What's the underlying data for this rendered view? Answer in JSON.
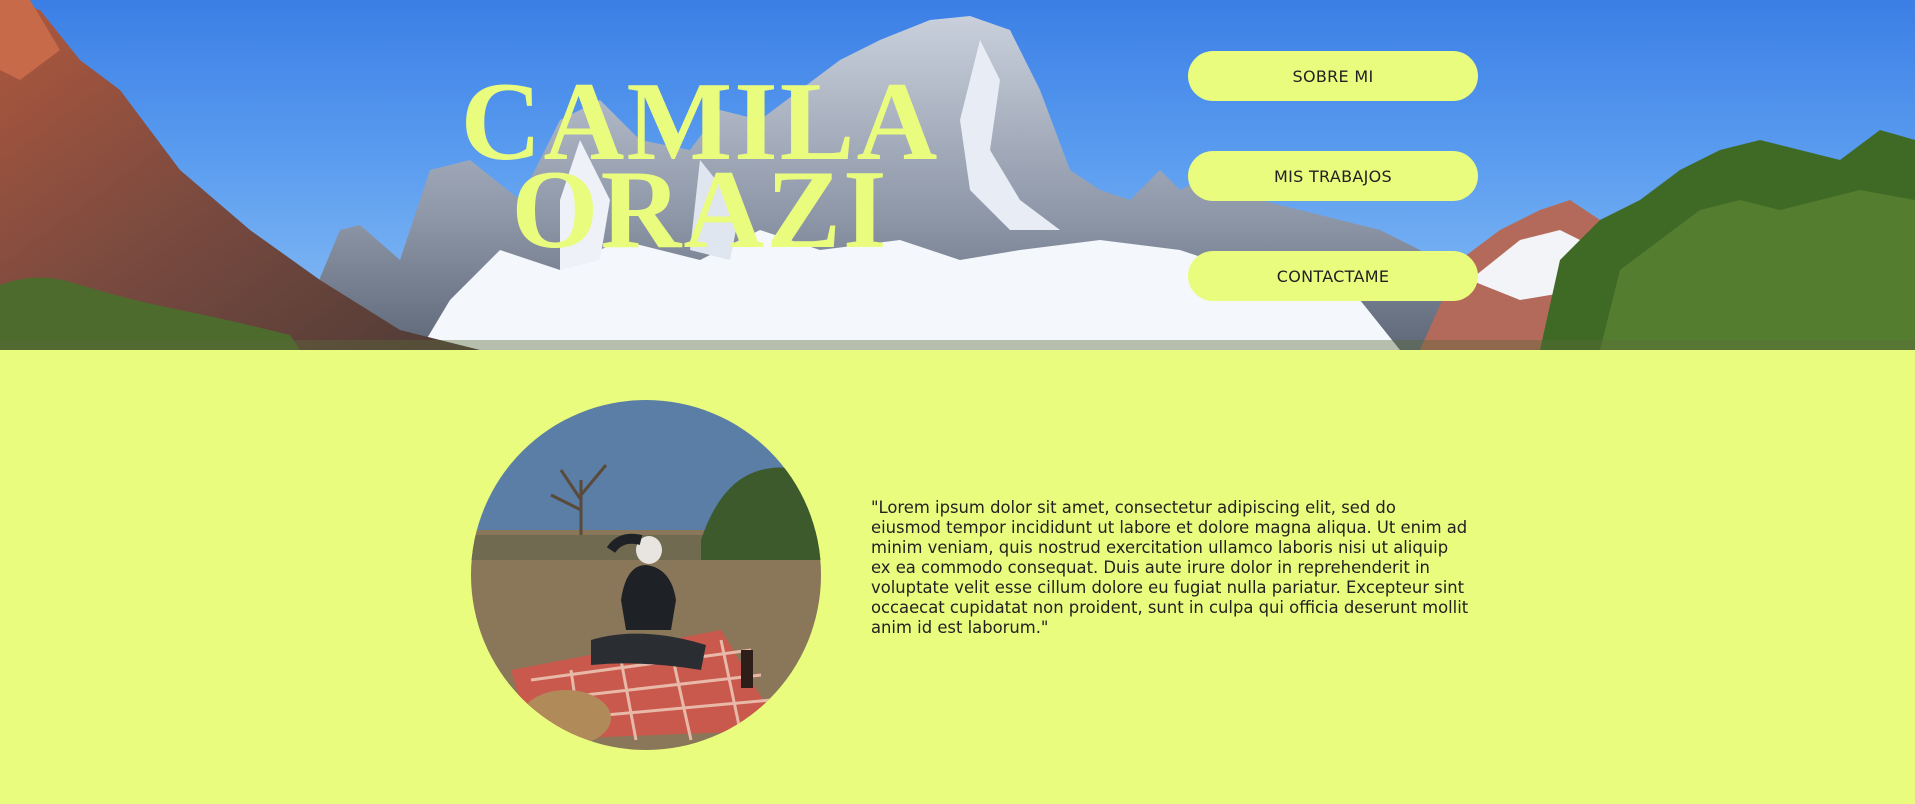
{
  "header": {
    "name_line1": "CAMILA",
    "name_line2": "ORAZI"
  },
  "nav": {
    "items": [
      {
        "label": "SOBRE MI"
      },
      {
        "label": "MIS TRABAJOS"
      },
      {
        "label": "CONTACTAME"
      }
    ]
  },
  "about": {
    "quote": "\"Lorem ipsum dolor sit amet, consectetur adipiscing elit, sed do eiusmod tempor incididunt ut labore et dolore magna aliqua. Ut enim ad minim veniam, quis nostrud exercitation ullamco laboris nisi ut aliquip ex ea commodo consequat. Duis aute irure dolor in reprehenderit in voluptate velit esse cillum dolore eu fugiat nulla pariatur. Excepteur sint occaecat cupidatat non proident, sunt in culpa qui officia deserunt mollit anim id est laborum.\""
  },
  "colors": {
    "accent": "#e9fc7e",
    "sky": "#3b7fe6",
    "text": "#222222"
  }
}
